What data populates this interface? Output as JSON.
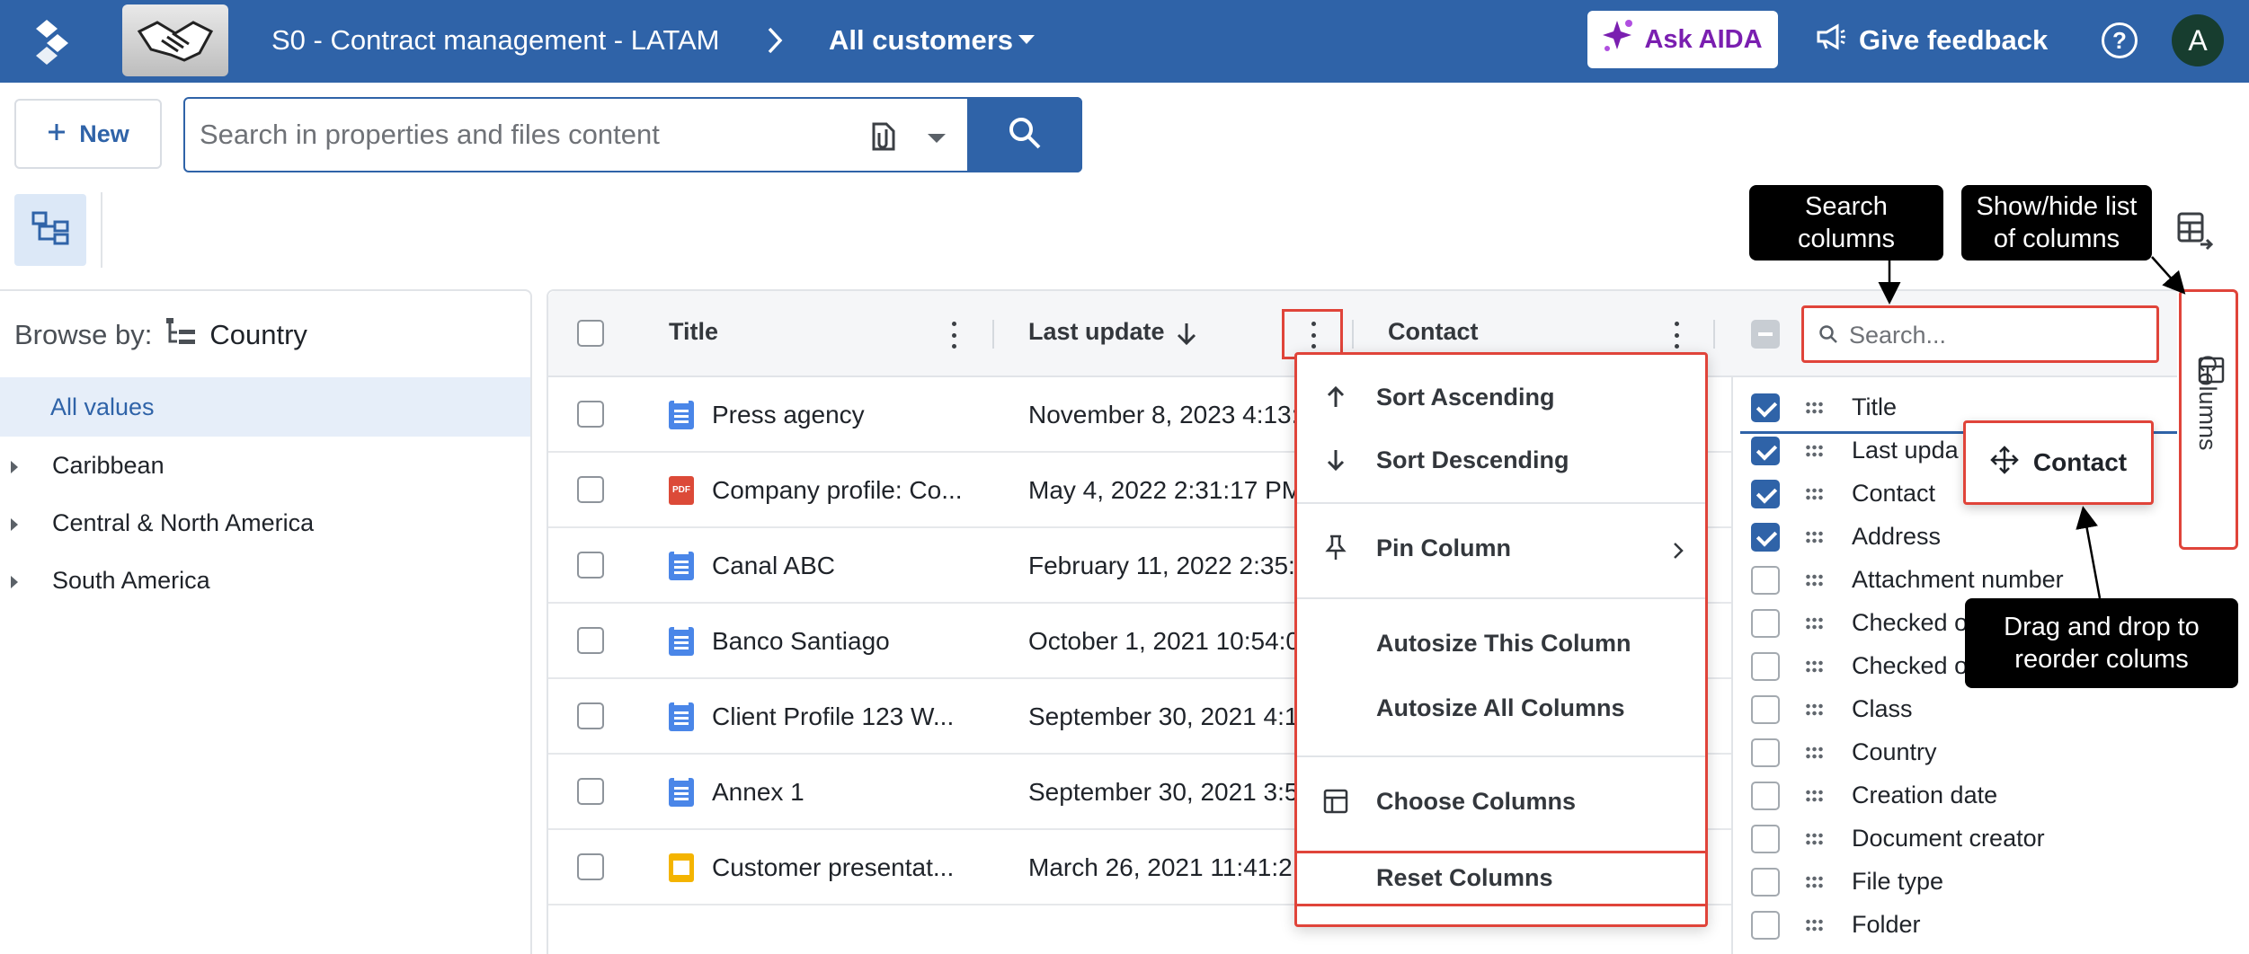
{
  "header": {
    "breadcrumb_app": "S0 - Contract management - LATAM",
    "breadcrumb_view": "All customers",
    "ask_aida": "Ask AIDA",
    "give_feedback": "Give feedback",
    "help": "?",
    "avatar_initial": "A",
    "brand_color": "#2f63a8"
  },
  "toolbar": {
    "new_label": "New",
    "search_placeholder": "Search in properties and files content"
  },
  "browse": {
    "label": "Browse by:",
    "field": "Country",
    "all_values": "All values",
    "items": [
      "Caribbean",
      "Central & North America",
      "South America"
    ]
  },
  "grid": {
    "columns": [
      "Title",
      "Last update",
      "Contact"
    ],
    "rows": [
      {
        "title": "Press agency",
        "date": "November 8, 2023 4:13:",
        "icon": "doc-icon"
      },
      {
        "title": "Company profile: Co...",
        "date": "May 4, 2022 2:31:17 PM",
        "icon": "pdf-icon"
      },
      {
        "title": "Canal ABC",
        "date": "February 11, 2022 2:35:",
        "icon": "doc-icon"
      },
      {
        "title": "Banco Santiago",
        "date": "October 1, 2021 10:54:0",
        "icon": "doc-icon"
      },
      {
        "title": "Client Profile 123 W...",
        "date": "September 30, 2021 4:1",
        "icon": "doc-icon"
      },
      {
        "title": "Annex 1",
        "date": "September 30, 2021 3:5",
        "icon": "doc-icon"
      },
      {
        "title": "Customer presentat...",
        "date": "March 26, 2021 11:41:2",
        "icon": "slide-icon"
      }
    ],
    "pdf_badge": "PDF"
  },
  "column_menu": {
    "sort_asc": "Sort Ascending",
    "sort_desc": "Sort Descending",
    "pin": "Pin Column",
    "autosize_this": "Autosize This Column",
    "autosize_all": "Autosize All Columns",
    "choose": "Choose Columns",
    "reset": "Reset Columns"
  },
  "columns_panel": {
    "search_placeholder": "Search...",
    "tab_label": "Columns",
    "items": [
      {
        "label": "Title",
        "checked": true
      },
      {
        "label": "Last upda",
        "checked": true
      },
      {
        "label": "Contact",
        "checked": true
      },
      {
        "label": "Address",
        "checked": true
      },
      {
        "label": "Attachment number",
        "checked": false
      },
      {
        "label": "Checked o",
        "checked": false
      },
      {
        "label": "Checked o",
        "checked": false
      },
      {
        "label": "Class",
        "checked": false
      },
      {
        "label": "Country",
        "checked": false
      },
      {
        "label": "Creation date",
        "checked": false
      },
      {
        "label": "Document creator",
        "checked": false
      },
      {
        "label": "File type",
        "checked": false
      },
      {
        "label": "Folder",
        "checked": false
      }
    ],
    "drag_ghost": "Contact"
  },
  "callouts": {
    "search_columns": "Search columns",
    "show_hide": "Show/hide list of columns",
    "drag_drop": "Drag and drop to reorder colums"
  },
  "colors": {
    "highlight": "#e0443a",
    "accent": "#2f63a8"
  }
}
